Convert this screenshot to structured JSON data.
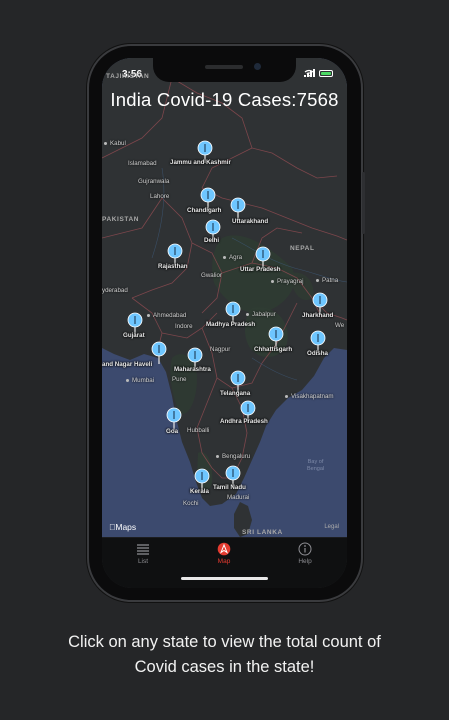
{
  "status_bar": {
    "time": "3:56"
  },
  "app": {
    "title": "India Covid-19 Cases:7568"
  },
  "map": {
    "countries": {
      "tajikistan": "TAJIKISTAN",
      "pakistan": "PAKISTAN",
      "nepal": "NEPAL",
      "sri_lanka": "SRI LANKA"
    },
    "cities": {
      "kabul": "Kabul",
      "islamabad": "Islamabad",
      "gujranwala": "Gujranwala",
      "lahore": "Lahore",
      "gwalior": "Gwalior",
      "agra": "Agra",
      "prayagraj": "Prayagraj",
      "patna": "Patna",
      "hyderabad_pk": "yderabad",
      "ahmedabad": "Ahmedabad",
      "indore": "Indore",
      "jabalpur": "Jabalpur",
      "nagpur": "Nagpur",
      "mumbai": "Mumbai",
      "pune": "Pune",
      "visakhapatnam": "Visakhapatnam",
      "hubballi": "Hubballi",
      "bengaluru": "Bengaluru",
      "madurai": "Madurai",
      "kochi": "Kochi",
      "yangon_edge": "We"
    },
    "sea_label": "Bay of\nBengal",
    "states": [
      {
        "name": "Jammu and Kashmir"
      },
      {
        "name": "Chandigarh"
      },
      {
        "name": "Uttarakhand"
      },
      {
        "name": "Delhi"
      },
      {
        "name": "Rajasthan"
      },
      {
        "name": "Uttar Pradesh"
      },
      {
        "name": "Jharkhand"
      },
      {
        "name": "Madhya Pradesh"
      },
      {
        "name": "Gujarat"
      },
      {
        "name": "Chhattisgarh"
      },
      {
        "name": "Odisha"
      },
      {
        "name": "and Nagar Haveli"
      },
      {
        "name": "Maharashtra"
      },
      {
        "name": "Telangana"
      },
      {
        "name": "Andhra Pradesh"
      },
      {
        "name": "Goa"
      },
      {
        "name": "Kerala"
      },
      {
        "name": "Tamil Nadu"
      }
    ],
    "attribution": "Maps",
    "legal": "Legal",
    "pin_color": "#6ec6ff"
  },
  "tabbar": {
    "tabs": [
      {
        "label": "List",
        "icon": "list-icon",
        "active": false
      },
      {
        "label": "Map",
        "icon": "map-compass-icon",
        "active": true
      },
      {
        "label": "Help",
        "icon": "info-icon",
        "active": false
      }
    ],
    "active_color": "#e53b30"
  },
  "caption": {
    "line1": "Click on any state to view  the total count of",
    "line2": "Covid cases in the state!"
  }
}
